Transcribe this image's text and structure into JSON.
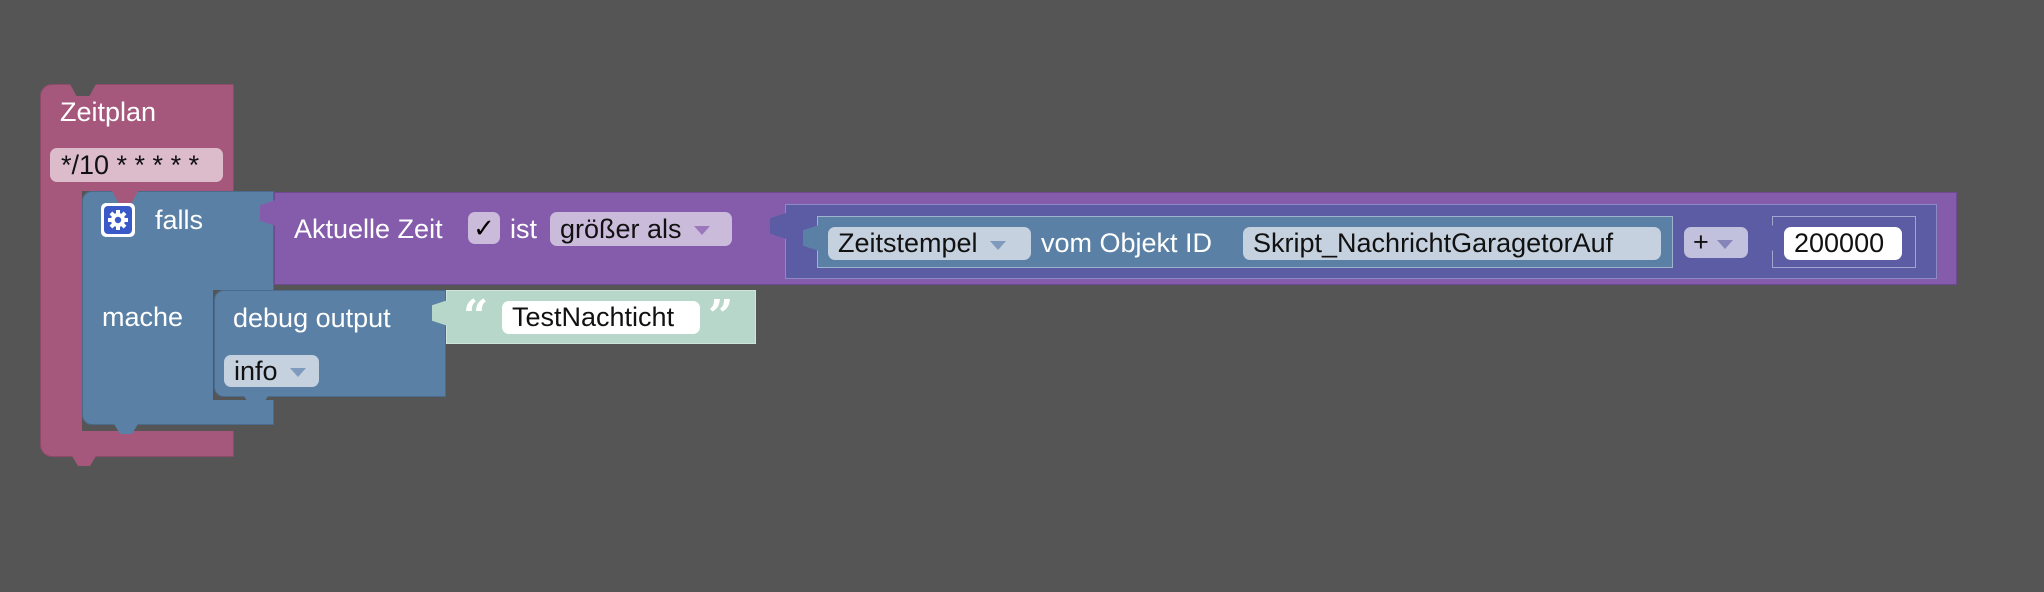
{
  "schedule_block": {
    "title": "Zeitplan",
    "cron": "*/10 * * * * *"
  },
  "if_block": {
    "falls_label": "falls",
    "mache_label": "mache"
  },
  "compare_block": {
    "left_label": "Aktuelle Zeit",
    "checkbox_mark": "✓",
    "ist_label": "ist",
    "operator": "größer als"
  },
  "math_block": {
    "timestamp_dropdown": "Zeitstempel",
    "object_label": "vom Objekt ID",
    "object_id": "Skript_NachrichtGaragetorAuf",
    "op": "+",
    "number": "200000"
  },
  "debug_block": {
    "label": "debug output",
    "level": "info"
  },
  "text_block": {
    "open_quote": "“",
    "value": "TestNachticht",
    "close_quote": "”"
  },
  "colors": {
    "schedule": "#a5587b",
    "if": "#5b80a5",
    "compare": "#845cab",
    "math": "#5c5ca5",
    "text": "#b6d7c9",
    "background": "#555555"
  }
}
